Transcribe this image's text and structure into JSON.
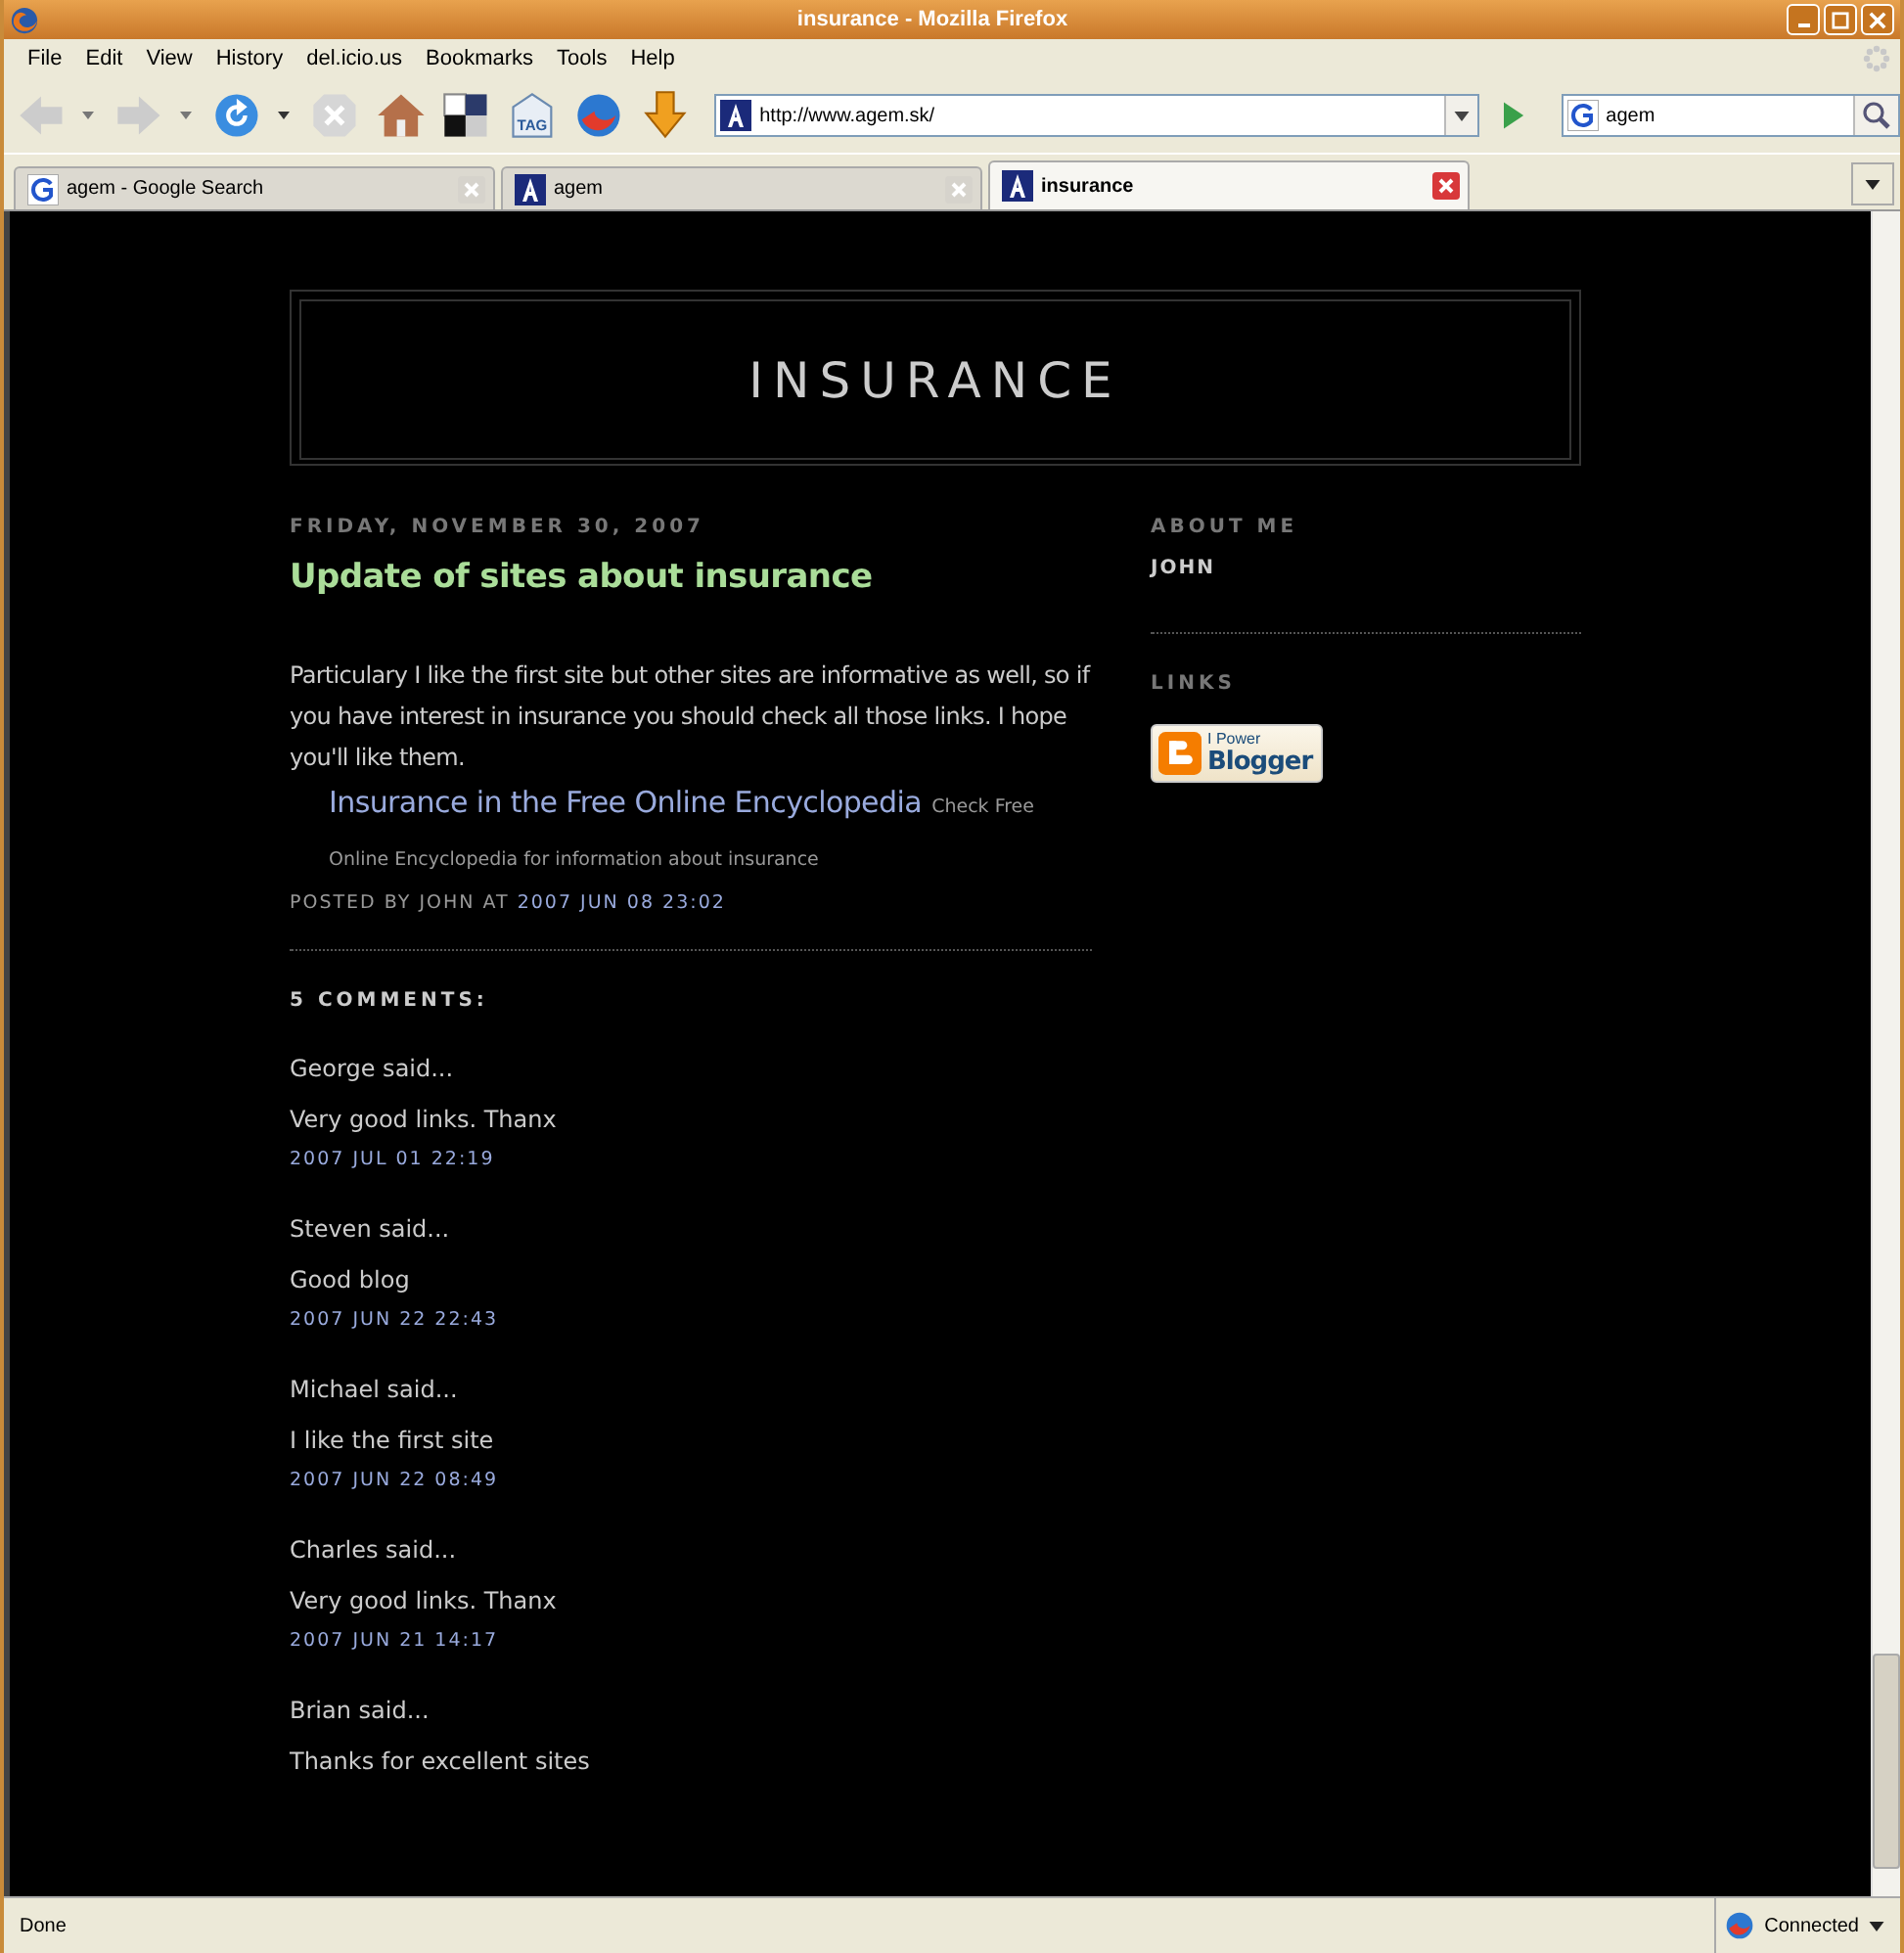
{
  "window": {
    "title": "insurance - Mozilla Firefox"
  },
  "menu": [
    "File",
    "Edit",
    "View",
    "History",
    "del.icio.us",
    "Bookmarks",
    "Tools",
    "Help"
  ],
  "tag_button": {
    "label": "TAG"
  },
  "address": {
    "value": "http://www.agem.sk/"
  },
  "search": {
    "value": "agem"
  },
  "tabs": [
    {
      "label": "agem - Google Search",
      "selected": false,
      "kind": "google"
    },
    {
      "label": "agem",
      "selected": false,
      "kind": "site"
    },
    {
      "label": "insurance",
      "selected": true,
      "kind": "site"
    }
  ],
  "blog": {
    "title": "INSURANCE",
    "date": "FRIDAY, NOVEMBER 30, 2007",
    "post_title": "Update of sites about insurance",
    "post_body": "Particulary I like the first site but other sites are informative as well, so if you have interest in insurance you should check all those links. I hope you'll like them.",
    "link": {
      "text": "Insurance in the Free Online Encyclopedia",
      "description": "Check Free Online Encyclopedia for information about insurance"
    },
    "posted_by": "POSTED BY JOHN AT",
    "post_time": "2007 JUN 08 23:02",
    "comments_heading": "5 COMMENTS:",
    "comments": [
      {
        "author": "George said...",
        "text": "Very good links. Thanx",
        "time": "2007 JUL 01 22:19"
      },
      {
        "author": "Steven said...",
        "text": "Good blog",
        "time": "2007 JUN 22 22:43"
      },
      {
        "author": "Michael said...",
        "text": "I like the first site",
        "time": "2007 JUN 22 08:49"
      },
      {
        "author": "Charles said...",
        "text": "Very good links. Thanx",
        "time": "2007 JUN 21 14:17"
      },
      {
        "author": "Brian said...",
        "text": "Thanks for excellent sites"
      }
    ]
  },
  "sidebar": {
    "about_heading": "ABOUT ME",
    "name": "JOHN",
    "links_heading": "LINKS",
    "badge": {
      "small": "I Power",
      "big": "Blogger"
    }
  },
  "status_bar": {
    "text": "Done",
    "connection": "Connected"
  }
}
